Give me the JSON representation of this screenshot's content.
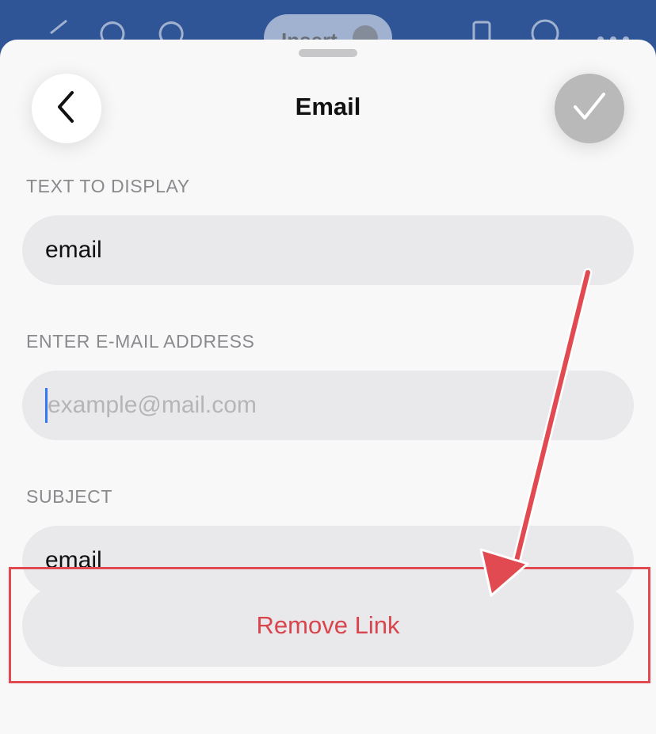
{
  "topbar": {
    "insert_label": "Insert",
    "icons": [
      "close-icon",
      "undo-icon",
      "redo-icon",
      "phone-view-icon",
      "search-icon",
      "more-icon"
    ]
  },
  "sheet": {
    "title": "Email",
    "back_icon": "chevron-left-icon",
    "done_icon": "checkmark-icon"
  },
  "fields": {
    "display_text": {
      "label": "TEXT TO DISPLAY",
      "value": "email"
    },
    "email_address": {
      "label": "ENTER E-MAIL ADDRESS",
      "value": "",
      "placeholder": "example@mail.com"
    },
    "subject": {
      "label": "SUBJECT",
      "value": "email"
    }
  },
  "actions": {
    "remove_link_label": "Remove Link"
  },
  "colors": {
    "app_bar": "#2f5597",
    "sheet_bg": "#f8f8f8",
    "field_bg": "#e9e9eb",
    "destructive": "#d9454c",
    "annotation": "#e04a50",
    "caret": "#3478f6"
  }
}
